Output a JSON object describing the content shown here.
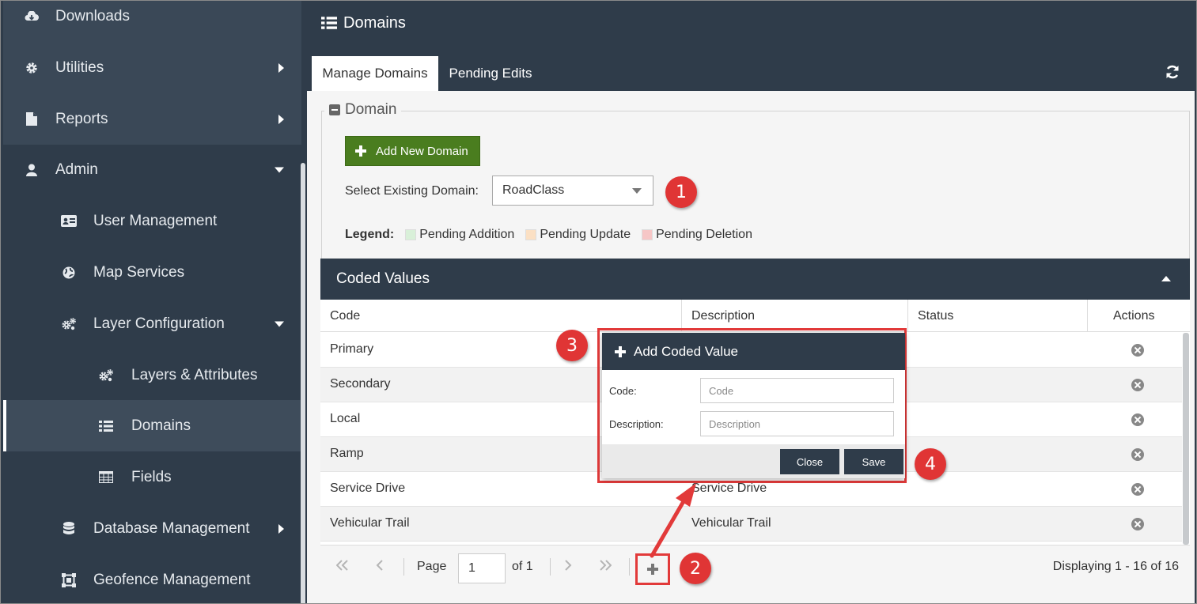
{
  "sidebar": {
    "items": [
      {
        "label": "Downloads",
        "icon": "download-icon"
      },
      {
        "label": "Utilities",
        "icon": "gear-icon"
      },
      {
        "label": "Reports",
        "icon": "file-icon"
      },
      {
        "label": "Admin",
        "icon": "user-icon"
      },
      {
        "label": "User Management",
        "icon": "id-card-icon"
      },
      {
        "label": "Map Services",
        "icon": "globe-icon"
      },
      {
        "label": "Layer Configuration",
        "icon": "gears-icon"
      },
      {
        "label": "Layers & Attributes",
        "icon": "gears-icon"
      },
      {
        "label": "Domains",
        "icon": "list-icon"
      },
      {
        "label": "Fields",
        "icon": "table-icon"
      },
      {
        "label": "Database Management",
        "icon": "database-icon"
      },
      {
        "label": "Geofence Management",
        "icon": "geofence-icon"
      }
    ]
  },
  "header": {
    "title": "Domains"
  },
  "tabs": {
    "manage": "Manage Domains",
    "pending": "Pending Edits"
  },
  "domain": {
    "section_title": "Domain",
    "add_button": "Add New Domain",
    "select_label": "Select Existing Domain:",
    "selected": "RoadClass",
    "legend_label": "Legend:",
    "legend": [
      {
        "label": "Pending Addition",
        "color": "#d9f0d9"
      },
      {
        "label": "Pending Update",
        "color": "#fbe0c4"
      },
      {
        "label": "Pending Deletion",
        "color": "#f6c6c6"
      }
    ]
  },
  "coded_values": {
    "title": "Coded Values",
    "columns": {
      "code": "Code",
      "description": "Description",
      "status": "Status",
      "actions": "Actions"
    },
    "rows": [
      {
        "code": "Primary",
        "description": ""
      },
      {
        "code": "Secondary",
        "description": ""
      },
      {
        "code": "Local",
        "description": ""
      },
      {
        "code": "Ramp",
        "description": ""
      },
      {
        "code": "Service Drive",
        "description": "Service Drive"
      },
      {
        "code": "Vehicular Trail",
        "description": "Vehicular Trail"
      }
    ]
  },
  "pager": {
    "page_label": "Page",
    "page_value": "1",
    "of_label": "of 1",
    "displaying": "Displaying 1 - 16 of 16"
  },
  "modal": {
    "title": "Add Coded Value",
    "code_label": "Code:",
    "code_placeholder": "Code",
    "description_label": "Description:",
    "description_placeholder": "Description",
    "close_label": "Close",
    "save_label": "Save"
  },
  "callouts": [
    "1",
    "2",
    "3",
    "4"
  ],
  "colors": {
    "nav": "#2f3c4a",
    "add_button": "#4a7d1f",
    "callout": "#e03535"
  }
}
